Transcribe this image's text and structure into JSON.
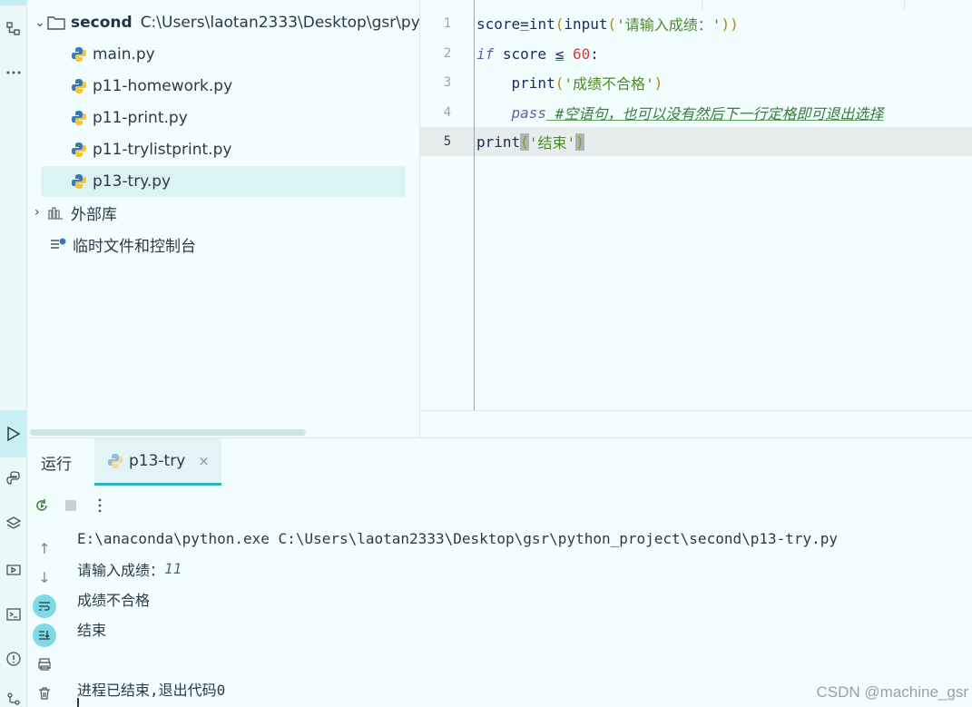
{
  "project": {
    "folder_name": "second",
    "folder_path": "C:\\Users\\laotan2333\\Desktop\\gsr\\py",
    "files": [
      "main.py",
      "p11-homework.py",
      "p11-print.py",
      "p11-trylistprint.py",
      "p13-try.py"
    ],
    "selected_file": "p13-try.py",
    "external_libs": "外部库",
    "scratches": "临时文件和控制台"
  },
  "editor": {
    "line_numbers": [
      "1",
      "2",
      "3",
      "4",
      "5"
    ],
    "current_line": "5",
    "lines": {
      "l1": {
        "a": "score",
        "b": "=",
        "c": "int",
        "d": "(",
        "e": "input",
        "f": "(",
        "g": "'请输入成绩：'",
        "h": "))"
      },
      "l2": {
        "a": "if",
        "b": " score ",
        "c": "≤",
        "d": " 60",
        "e": ":"
      },
      "l3": {
        "a": "    print",
        "b": "(",
        "c": "'成绩不合格'",
        "d": ")"
      },
      "l4": {
        "a": "    pass",
        "b": " #空语句，也可以没有然后下一行定格即可退出选择"
      },
      "l5": {
        "a": "print",
        "b": "(",
        "c": "'结束'",
        "d": ")"
      }
    }
  },
  "run_panel": {
    "label": "运行",
    "tab_label": "p13-try",
    "tab_close": "×",
    "console": {
      "command": "E:\\anaconda\\python.exe C:\\Users\\laotan2333\\Desktop\\gsr\\python_project\\second\\p13-try.py",
      "prompt": "请输入成绩：",
      "input_value": "11",
      "output1": "成绩不合格",
      "output2": "结束",
      "exit_msg": "进程已结束,退出代码0"
    }
  },
  "watermark": "CSDN @machine_gsr",
  "icons": [
    "python-file-icon",
    "folder-icon",
    "library-icon",
    "scratch-icon",
    "rerun-icon",
    "stop-icon",
    "more-icon",
    "run-icon",
    "up-arrow-icon",
    "down-arrow-icon",
    "soft-wrap-icon",
    "scroll-end-icon",
    "print-icon",
    "trash-icon"
  ]
}
